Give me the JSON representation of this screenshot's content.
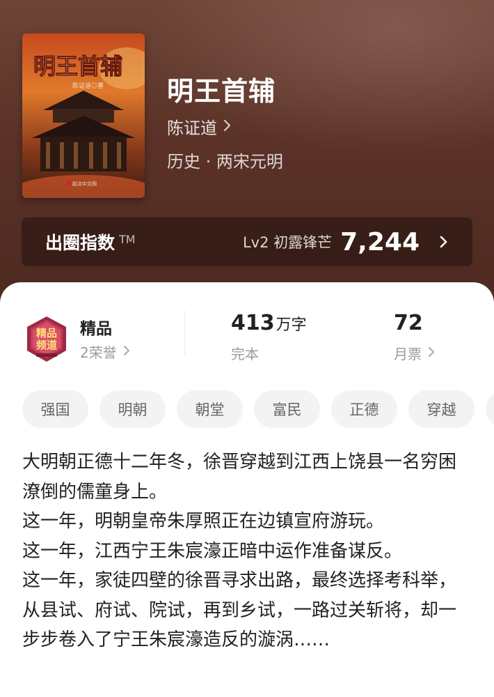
{
  "book": {
    "title": "明王首辅",
    "author": "陈证道",
    "genre": "历史 · 两宋元明",
    "cover": {
      "title_text": "明王首辅",
      "author_text": "陈证道◎著",
      "publisher_text": "起点中文网"
    }
  },
  "popularity": {
    "label": "出圈指数",
    "tm": "TM",
    "level": "Lv2 初露锋芒",
    "value": "7,244"
  },
  "honor": {
    "badge_text_1": "精品",
    "badge_text_2": "频道",
    "title": "精品",
    "subtitle": "2荣誉"
  },
  "stats": {
    "words_number": "413",
    "words_unit": "万字",
    "status": "完本",
    "votes_number": "72",
    "votes_label": "月票"
  },
  "tags": [
    "强国",
    "明朝",
    "朝堂",
    "富民",
    "正德",
    "穿越"
  ],
  "synopsis": [
    "大明朝正德十二年冬，徐晋穿越到江西上饶县一名穷困潦倒的儒童身上。",
    "这一年，明朝皇帝朱厚照正在边镇宣府游玩。",
    "这一年，江西宁王朱宸濠正暗中运作准备谋反。",
    "这一年，家徒四壁的徐晋寻求出路，最终选择考科举，从县试、府试、院试，再到乡试，一路过关斩将，却一步步卷入了宁王朱宸濠造反的漩涡……"
  ],
  "colors": {
    "header_bg": "#5b3227",
    "accent_badge": "#b8324a"
  }
}
